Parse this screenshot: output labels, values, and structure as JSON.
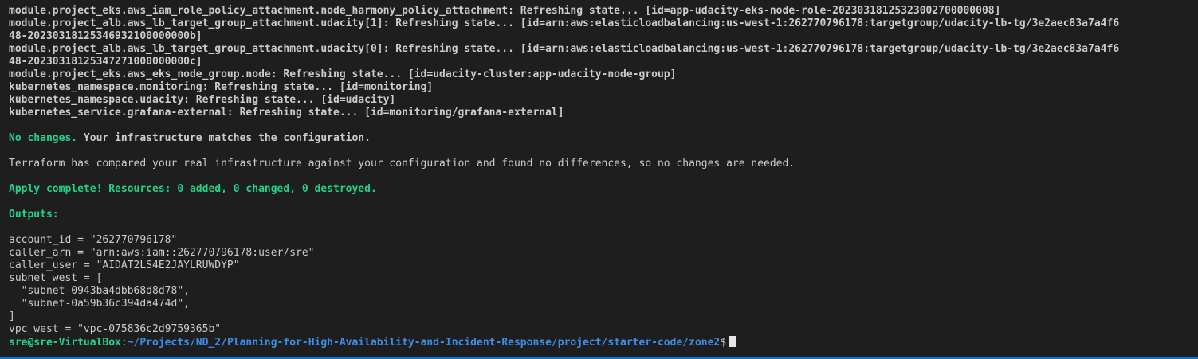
{
  "terminal": {
    "refresh_lines": [
      "module.project_eks.aws_iam_role_policy_attachment.node_harmony_policy_attachment: Refreshing state... [id=app-udacity-eks-node-role-20230318125323002700000008]",
      "module.project_alb.aws_lb_target_group_attachment.udacity[1]: Refreshing state... [id=arn:aws:elasticloadbalancing:us-west-1:262770796178:targetgroup/udacity-lb-tg/3e2aec83a7a4f6",
      "48-20230318125346932100000000b]",
      "module.project_alb.aws_lb_target_group_attachment.udacity[0]: Refreshing state... [id=arn:aws:elasticloadbalancing:us-west-1:262770796178:targetgroup/udacity-lb-tg/3e2aec83a7a4f6",
      "48-20230318125347271000000000c]",
      "module.project_eks.aws_eks_node_group.node: Refreshing state... [id=udacity-cluster:app-udacity-node-group]",
      "kubernetes_namespace.monitoring: Refreshing state... [id=monitoring]",
      "kubernetes_namespace.udacity: Refreshing state... [id=udacity]",
      "kubernetes_service.grafana-external: Refreshing state... [id=monitoring/grafana-external]"
    ],
    "no_changes_label": "No changes.",
    "no_changes_rest": " Your infrastructure matches the configuration.",
    "compared_message": "Terraform has compared your real infrastructure against your configuration and found no differences, so no changes are needed.",
    "apply_complete": "Apply complete! Resources: 0 added, 0 changed, 0 destroyed.",
    "outputs_header": "Outputs:",
    "outputs": [
      "account_id = \"262770796178\"",
      "caller_arn = \"arn:aws:iam::262770796178:user/sre\"",
      "caller_user = \"AIDAT2LS4E2JAYLRUWDYP\"",
      "subnet_west = [",
      "  \"subnet-0943ba4dbb68d8d78\",",
      "  \"subnet-0a59b36c394da474d\",",
      "]",
      "vpc_west = \"vpc-075836c2d9759365b\""
    ],
    "prompt": {
      "user_host": "sre@sre-VirtualBox",
      "separator": ":",
      "path": "~/Projects/ND_2/Planning-for-High-Availability-and-Incident-Response/project/starter-code/zone2",
      "symbol": "$"
    },
    "colors": {
      "background": "#1e1e1e",
      "text": "#cccccc",
      "success_green": "#23d18b",
      "path_blue": "#3b8eea",
      "status_bar": "#007acc"
    }
  }
}
